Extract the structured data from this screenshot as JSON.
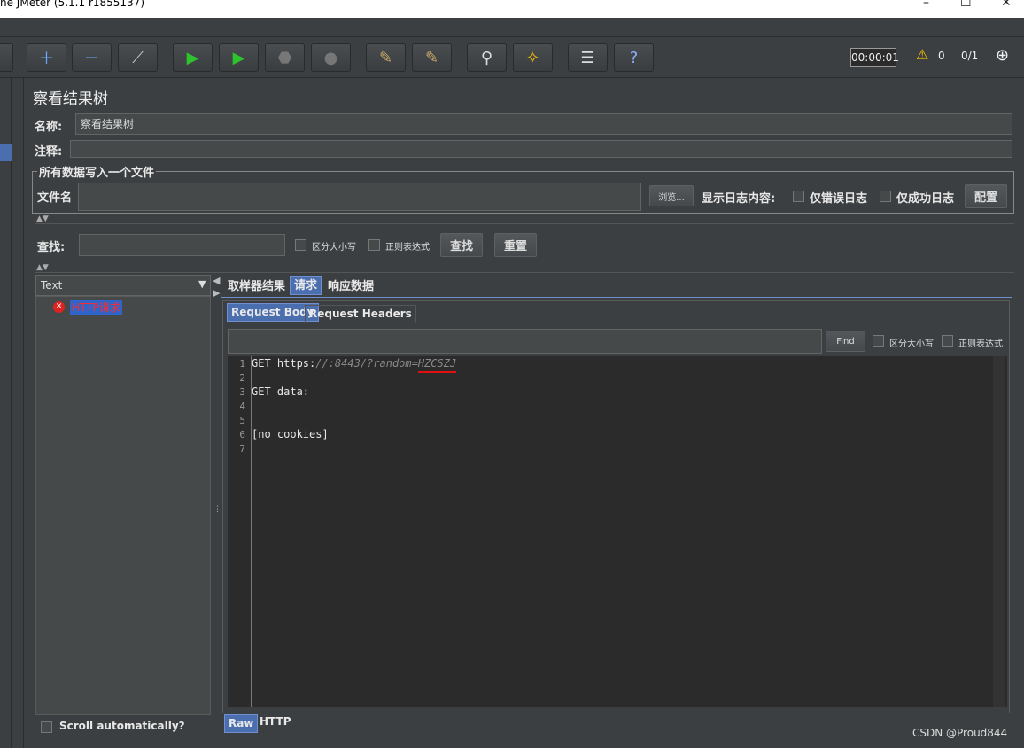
{
  "window": {
    "title": "he JMeter (5.1.1 r1855137)",
    "min": "–",
    "max": "☐",
    "close": "✕"
  },
  "toolbar": {
    "timer": "00:00:01",
    "warn_count": "0",
    "threads": "0/1"
  },
  "panel": {
    "title": "察看结果树",
    "name_label": "名称:",
    "name_value": "察看结果树",
    "comment_label": "注释:",
    "group_title": "所有数据写入一个文件",
    "file_label": "文件名",
    "browse": "浏览...",
    "show_log": "显示日志内容:",
    "errors_only": "仅错误日志",
    "success_only": "仅成功日志",
    "config": "配置",
    "search_label": "查找:",
    "case_sensitive": "区分大小写",
    "regex": "正则表达式",
    "search_btn": "查找",
    "reset_btn": "重置"
  },
  "tree": {
    "renderer": "Text",
    "items": [
      {
        "label": "HTTP请求"
      }
    ],
    "scroll_auto": "Scroll automatically?"
  },
  "tabs": {
    "sampler": "取样器结果",
    "request": "请求",
    "response": "响应数据"
  },
  "subtabs": {
    "body": "Request Body",
    "headers": "Request Headers"
  },
  "find": {
    "btn": "Find",
    "case": "区分大小写",
    "regex": "正则表达式"
  },
  "editor": {
    "lines": [
      "1",
      "2",
      "3",
      "4",
      "5",
      "6",
      "7"
    ],
    "line1_a": "GET https:",
    "line1_b": "//:8443/?random=",
    "line1_c": "HZCSZJ",
    "line3": "GET data:",
    "line6": "[no cookies]"
  },
  "bottom_tabs": {
    "raw": "Raw",
    "http": "HTTP"
  },
  "watermark": "CSDN @Proud844"
}
